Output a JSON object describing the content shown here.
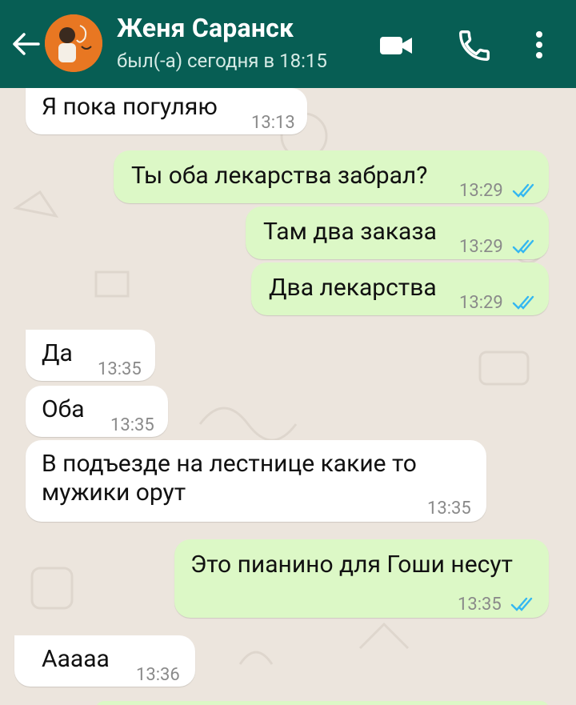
{
  "header": {
    "contact_name": "Женя Саранск",
    "status": "был(-а) сегодня в 18:15"
  },
  "messages": [
    {
      "dir": "in",
      "text": "Я пока погуляю",
      "time": "13:13"
    },
    {
      "dir": "out",
      "text": "Ты оба лекарства забрал?",
      "time": "13:29",
      "status": "read"
    },
    {
      "dir": "out",
      "text": "Там два заказа",
      "time": "13:29",
      "status": "read"
    },
    {
      "dir": "out",
      "text": "Два лекарства",
      "time": "13:29",
      "status": "read"
    },
    {
      "dir": "in",
      "text": "Да",
      "time": "13:35"
    },
    {
      "dir": "in",
      "text": "Оба",
      "time": "13:35"
    },
    {
      "dir": "in",
      "text_line1": "В подъезде на лестнице какие то",
      "text_line2": "мужики орут",
      "time": "13:35"
    },
    {
      "dir": "out",
      "text": "Это пианино для Гоши несут",
      "time": "13:35",
      "status": "read"
    },
    {
      "dir": "in",
      "text": "Ааааа",
      "time": "13:36"
    }
  ],
  "colors": {
    "header": "#075e54",
    "chat_background": "#ece5dd",
    "outgoing_bubble": "#dcf8c6",
    "incoming_bubble": "#ffffff",
    "read_ticks": "#34b7f1"
  },
  "icons": [
    "back-arrow-icon",
    "video-call-icon",
    "phone-call-icon",
    "more-options-icon",
    "double-check-icon"
  ]
}
